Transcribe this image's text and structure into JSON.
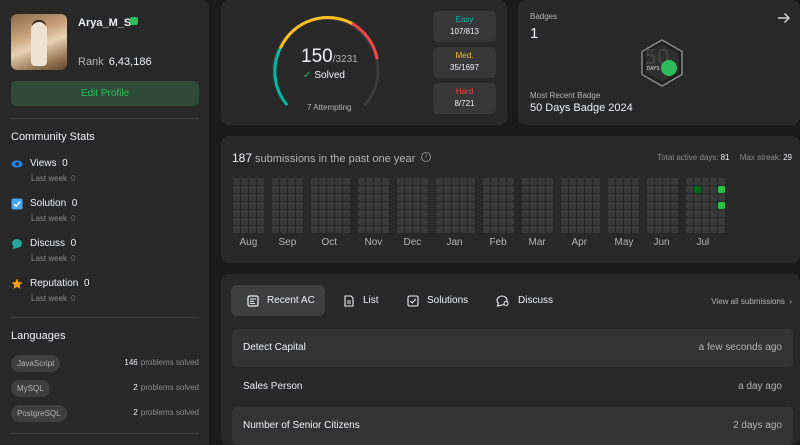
{
  "profile": {
    "username": "Arya_M_S",
    "rank_label": "Rank",
    "rank_value": "6,43,186",
    "edit_profile": "Edit Profile"
  },
  "community": {
    "title": "Community Stats",
    "stats": [
      {
        "label": "Views",
        "value": "0",
        "sub_label": "Last week",
        "sub_value": "0",
        "icon": "eye-icon",
        "color": "#1e88e5"
      },
      {
        "label": "Solution",
        "value": "0",
        "sub_label": "Last week",
        "sub_value": "0",
        "icon": "checkbox-icon",
        "color": "#42a5f5"
      },
      {
        "label": "Discuss",
        "value": "0",
        "sub_label": "Last week",
        "sub_value": "0",
        "icon": "chat-icon",
        "color": "#26a69a"
      },
      {
        "label": "Reputation",
        "value": "0",
        "sub_label": "Last week",
        "sub_value": "0",
        "icon": "star-icon",
        "color": "#ffa116"
      }
    ]
  },
  "languages": {
    "title": "Languages",
    "items": [
      {
        "name": "JavaScript",
        "count": "146",
        "suffix": "problems solved"
      },
      {
        "name": "MySQL",
        "count": "2",
        "suffix": "problems solved"
      },
      {
        "name": "PostgreSQL",
        "count": "2",
        "suffix": "problems solved"
      }
    ]
  },
  "solved": {
    "solved": "150",
    "total": "/3231",
    "solved_label": "Solved",
    "attempting": "7 Attempting",
    "difficulties": [
      {
        "name": "Easy",
        "value": "107/813",
        "color": "#00b8a3"
      },
      {
        "name": "Med.",
        "value": "35/1697",
        "color": "#ffc01e"
      },
      {
        "name": "Hard",
        "value": "8/721",
        "color": "#ef4743"
      }
    ]
  },
  "badges": {
    "title": "Badges",
    "count": "1",
    "badge_days": "DAYS",
    "badge_number": "50",
    "recent_label": "Most Recent Badge",
    "recent_name": "50 Days Badge 2024"
  },
  "submissions": {
    "count": "187",
    "label": "submissions in the past one year",
    "total_active_label": "Total active days:",
    "total_active": "81",
    "max_streak_label": "Max streak:",
    "max_streak": "29",
    "months": [
      "Aug",
      "Sep",
      "Oct",
      "Nov",
      "Dec",
      "Jan",
      "Feb",
      "Mar",
      "Apr",
      "May",
      "Jun",
      "Jul"
    ],
    "week_groups": [
      4,
      4,
      5,
      4,
      4,
      5,
      4,
      4,
      5,
      4,
      4,
      5
    ],
    "active_cells": [
      [
        48,
        1,
        1
      ],
      [
        51,
        1,
        2
      ],
      [
        51,
        3,
        2
      ],
      [
        52,
        2,
        1
      ],
      [
        52,
        4,
        1
      ],
      [
        56,
        5,
        1
      ],
      [
        60,
        2,
        2
      ],
      [
        61,
        4,
        1
      ],
      [
        63,
        5,
        1
      ],
      [
        64,
        2,
        1
      ],
      [
        65,
        3,
        2
      ],
      [
        66,
        1,
        2
      ],
      [
        66,
        2,
        1
      ],
      [
        67,
        3,
        2
      ],
      [
        67,
        5,
        1
      ],
      [
        68,
        0,
        2
      ],
      [
        68,
        4,
        2
      ],
      [
        69,
        2,
        1
      ],
      [
        69,
        6,
        1
      ],
      [
        70,
        0,
        2
      ],
      [
        70,
        1,
        2
      ],
      [
        70,
        3,
        2
      ],
      [
        71,
        1,
        2
      ],
      [
        71,
        2,
        2
      ],
      [
        71,
        5,
        2
      ],
      [
        72,
        0,
        1
      ],
      [
        72,
        4,
        2
      ],
      [
        73,
        2,
        2
      ],
      [
        73,
        3,
        1
      ],
      [
        74,
        0,
        2
      ],
      [
        74,
        1,
        2
      ],
      [
        74,
        6,
        2
      ],
      [
        75,
        3,
        1
      ],
      [
        75,
        5,
        2
      ],
      [
        76,
        1,
        2
      ],
      [
        76,
        2,
        1
      ],
      [
        77,
        4,
        2
      ],
      [
        78,
        0,
        1
      ],
      [
        78,
        3,
        2
      ],
      [
        79,
        2,
        2
      ],
      [
        80,
        5,
        2
      ],
      [
        81,
        1,
        1
      ],
      [
        81,
        4,
        2
      ],
      [
        82,
        0,
        2
      ],
      [
        82,
        3,
        2
      ],
      [
        83,
        2,
        1
      ],
      [
        83,
        6,
        2
      ],
      [
        84,
        1,
        2
      ],
      [
        84,
        4,
        2
      ],
      [
        85,
        3,
        1
      ],
      [
        86,
        0,
        2
      ],
      [
        86,
        2,
        2
      ],
      [
        87,
        5,
        1
      ],
      [
        88,
        1,
        2
      ],
      [
        88,
        4,
        2
      ],
      [
        89,
        0,
        2
      ],
      [
        89,
        3,
        1
      ],
      [
        90,
        2,
        2
      ],
      [
        90,
        6,
        2
      ],
      [
        91,
        1,
        2
      ]
    ]
  },
  "recent": {
    "tabs": [
      {
        "label": "Recent AC",
        "icon": "recent-ac-icon",
        "active": true
      },
      {
        "label": "List",
        "icon": "list-icon",
        "active": false
      },
      {
        "label": "Solutions",
        "icon": "solutions-icon",
        "active": false
      },
      {
        "label": "Discuss",
        "icon": "discuss-icon",
        "active": false
      }
    ],
    "view_all": "View all submissions",
    "rows": [
      {
        "title": "Detect Capital",
        "when": "a few seconds ago"
      },
      {
        "title": "Sales Person",
        "when": "a day ago"
      },
      {
        "title": "Number of Senior Citizens",
        "when": "2 days ago"
      }
    ]
  },
  "colors": {
    "accent_green": "#2cbb5d",
    "heat_level1": "#016620",
    "heat_level2": "#28c244",
    "heat_empty": "#393939"
  }
}
